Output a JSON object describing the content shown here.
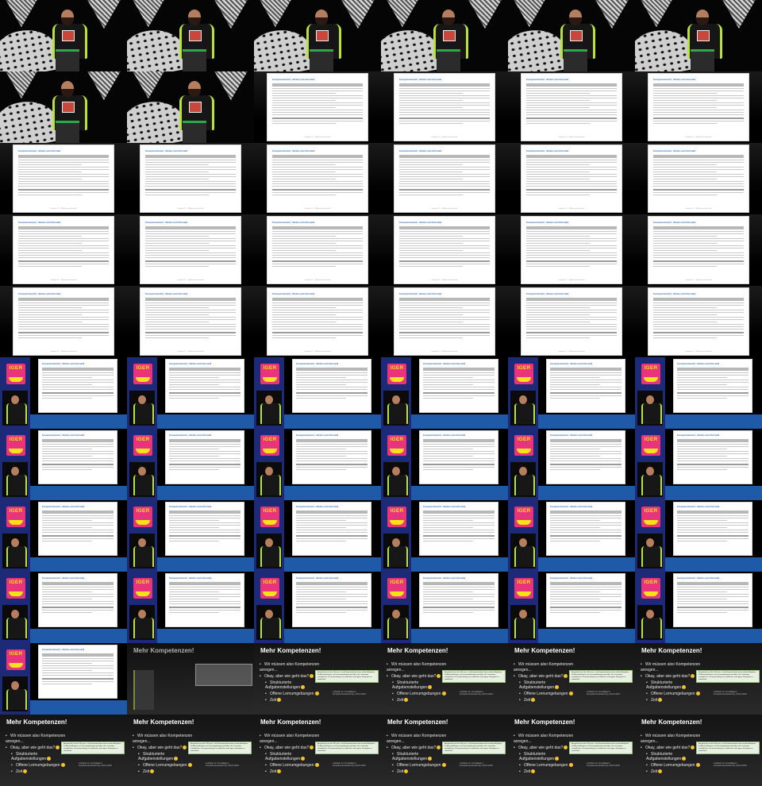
{
  "slide": {
    "title": "Mehr Kompetenzen!",
    "bullets": [
      {
        "marker": "•",
        "text": "Wir müssen also Kompetenzen anregen...",
        "sub": false
      },
      {
        "marker": "•",
        "text": "Okay, aber wie geht das?",
        "sub": false
      },
      {
        "marker": "•",
        "text": "Strukturierte Aufgabenstellungen",
        "sub": true
      },
      {
        "marker": "•",
        "text": "Offene Lernumgebungen",
        "sub": true
      },
      {
        "marker": "•",
        "text": "Zeit",
        "sub": true
      }
    ],
    "quote": "Ausgehend von den Wissens- und Kompetenzbereichen werden Aufgaben, Problemstellungen und Lernumgebungen gestaltet, die Lernenden ermöglichen, Zusammenhänge zu entdecken und eigene Strategien zu entwickeln.",
    "caption": "Lehrplan 21: Grundlagen / Kompetenzorientierung, Zürich 2016",
    "emoji_icon": "smile-emoji-icon"
  },
  "document": {
    "header": "Kompetenzbereich - Medien und Informatik",
    "footer": "Lehrplan 21 — Medien und Informatik"
  },
  "logo": {
    "text": "IGER"
  },
  "colors": {
    "accent_blue": "#1f5aa8",
    "navy": "#1c2a78",
    "logo_pink": "#e8347a",
    "logo_yellow": "#f9e11a",
    "vest_green": "#b9e23a",
    "quote_green": "#e6f2df"
  }
}
